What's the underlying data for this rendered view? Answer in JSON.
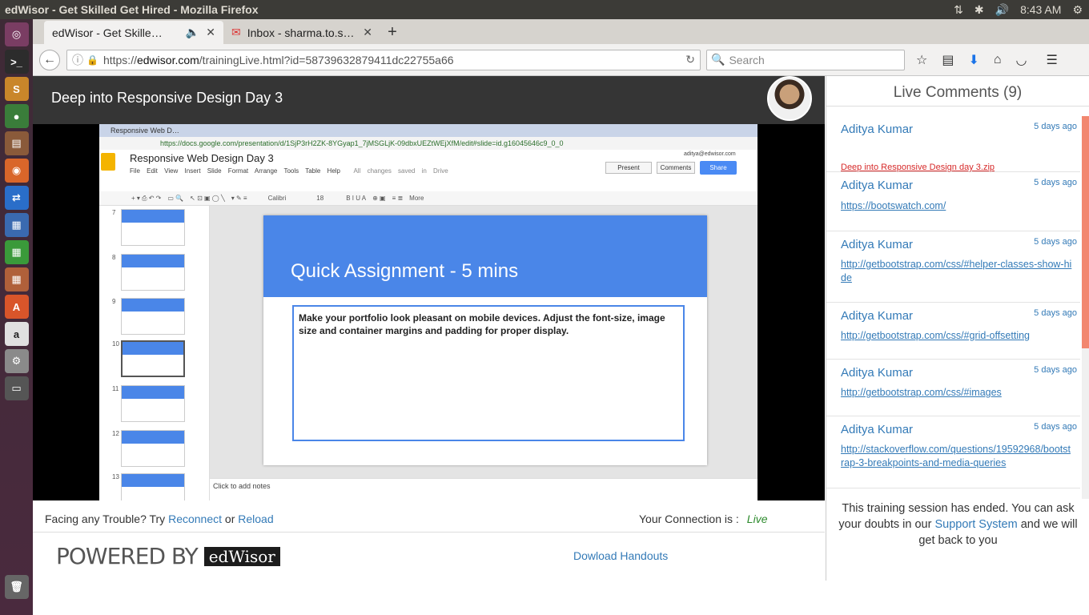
{
  "os": {
    "window_title": "edWisor - Get Skilled Get Hired - Mozilla Firefox",
    "clock": "8:43 AM"
  },
  "browser": {
    "tabs": [
      {
        "label": "edWisor - Get Skille…"
      },
      {
        "label": "Inbox - sharma.to.s…"
      }
    ],
    "url_prefix": "https://",
    "url_host": "edwisor.com",
    "url_path": "/trainingLive.html?id=58739632879411dc22755a66",
    "search_placeholder": "Search"
  },
  "header": {
    "title": "Deep into Responsive Design Day 3"
  },
  "video": {
    "chrome_tab": "Responsive Web D…",
    "chrome_url": "https://docs.google.com/presentation/d/1SjP3rH2ZK-8YGyap1_7jMSGLjK-09dbxUEZtWEjXfM/edit#slide=id.g16045646c9_0_0",
    "doc_title": "Responsive Web Design Day 3",
    "menus": "File Edit View Insert Slide Format Arrange Tools Table Help",
    "saved": "All changes saved in Drive",
    "account": "aditya@edwisor.com",
    "present": "Present",
    "comments": "Comments",
    "share": "Share",
    "font": "Calibri",
    "fontsize": "18",
    "more": "More",
    "thumb_numbers": [
      "7",
      "8",
      "9",
      "10",
      "11",
      "12",
      "13"
    ],
    "slide_title": "Quick Assignment - 5 mins",
    "slide_body": "Make your portfolio look pleasant on mobile devices. Adjust the font-size, image size and container margins and padding for proper display.",
    "notes": "Click to add notes"
  },
  "trouble": {
    "prefix": "Facing any Trouble? Try",
    "reconnect": "Reconnect",
    "or": "or",
    "reload": "Reload",
    "connection_label": "Your Connection is :",
    "connection_status": "Live"
  },
  "footer": {
    "powered_by": "POWERED BY",
    "brand": "edWisor",
    "handouts": "Dowload Handouts"
  },
  "comments": {
    "heading": "Live Comments (9)",
    "items": [
      {
        "name": "Aditya Kumar",
        "time": "5 days ago",
        "text": "Deep into Responsive Design day 3.zip"
      },
      {
        "name": "Aditya Kumar",
        "time": "5 days ago",
        "text": "https://bootswatch.com/"
      },
      {
        "name": "Aditya Kumar",
        "time": "5 days ago",
        "text": "http://getbootstrap.com/css/#helper-classes-show-hide"
      },
      {
        "name": "Aditya Kumar",
        "time": "5 days ago",
        "text": "http://getbootstrap.com/css/#grid-offsetting"
      },
      {
        "name": "Aditya Kumar",
        "time": "5 days ago",
        "text": "http://getbootstrap.com/css/#images"
      },
      {
        "name": "Aditya Kumar",
        "time": "5 days ago",
        "text": "http://stackoverflow.com/questions/19592968/bootstrap-3-breakpoints-and-media-queries"
      }
    ]
  },
  "notice": {
    "text_before": "This training session has ended. You can ask your doubts in our",
    "support_link": "Support System",
    "text_after": "and we will get back to you"
  },
  "colors": {
    "live_green": "#2e8b2e",
    "link_blue": "#337ab7",
    "scroll_accent": "#f2876f",
    "slide_blue": "#4a86e8"
  }
}
